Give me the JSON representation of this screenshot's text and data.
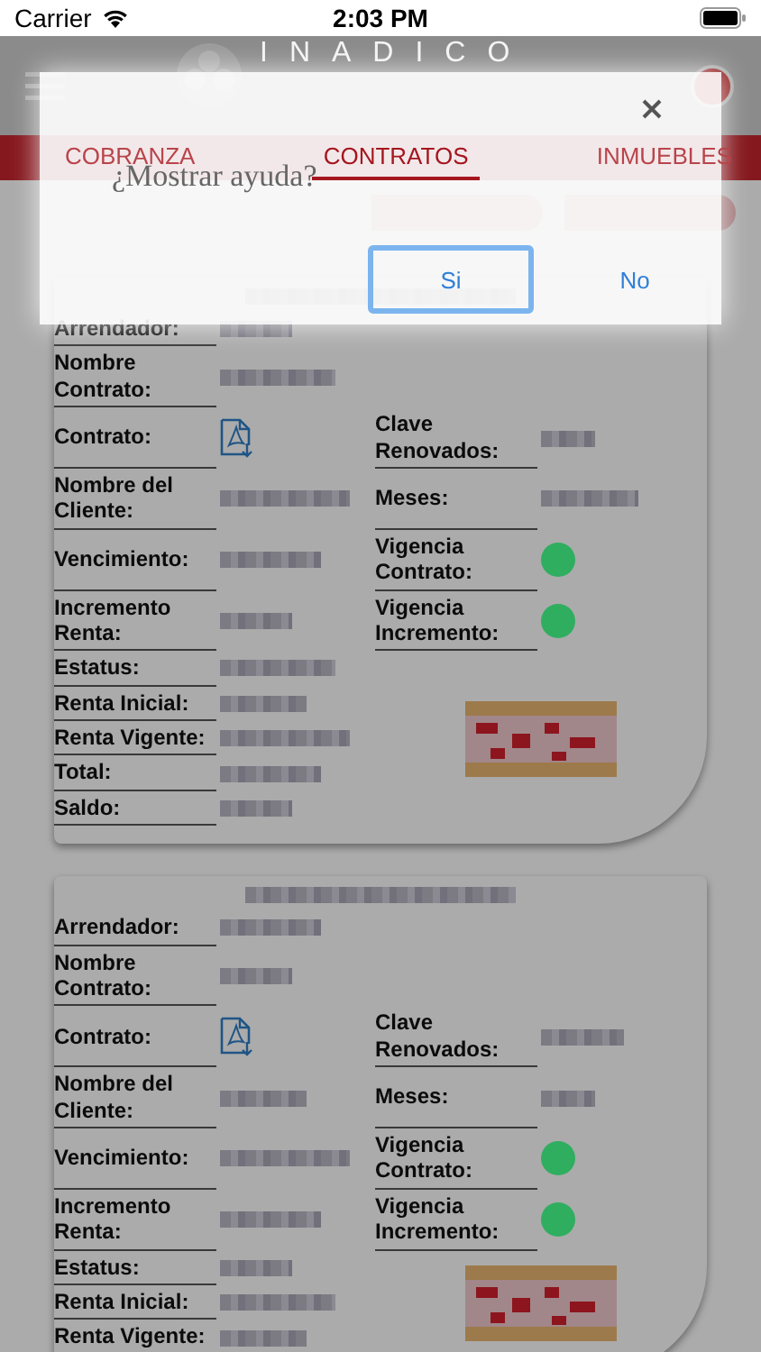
{
  "status_bar": {
    "carrier": "Carrier",
    "time": "2:03 PM"
  },
  "header": {
    "logo_text": "INADICO"
  },
  "tabs": [
    {
      "label": "COBRANZA",
      "selected": false
    },
    {
      "label": "CONTRATOS",
      "selected": true
    },
    {
      "label": "INMUEBLES",
      "selected": false
    }
  ],
  "cards": [
    {
      "rows": [
        {
          "label": "Arrendador:",
          "value": {
            "kind": "blurred"
          }
        },
        {
          "label": "Nombre Contrato:",
          "value": {
            "kind": "blurred"
          }
        },
        {
          "label": "Contrato:",
          "value": {
            "kind": "pdf"
          },
          "right": {
            "label": "Clave Renovados:",
            "value": {
              "kind": "blurred"
            }
          }
        },
        {
          "label": "Nombre del Cliente:",
          "value": {
            "kind": "blurred"
          },
          "right": {
            "label": "Meses:",
            "value": {
              "kind": "blurred"
            }
          }
        },
        {
          "label": "Vencimiento:",
          "value": {
            "kind": "blurred"
          },
          "right": {
            "label": "Vigencia Contrato:",
            "value": {
              "kind": "dot",
              "color": "#2fae5f"
            }
          }
        },
        {
          "label": "Incremento Renta:",
          "value": {
            "kind": "blurred"
          },
          "right": {
            "label": "Vigencia Incremento:",
            "value": {
              "kind": "dot",
              "color": "#2fae5f"
            }
          }
        },
        {
          "label": "Estatus:",
          "value": {
            "kind": "blurred"
          }
        },
        {
          "label": "Renta Inicial:",
          "value": {
            "kind": "blurred"
          }
        },
        {
          "label": "Renta Vigente:",
          "value": {
            "kind": "blurred"
          }
        },
        {
          "label": "Total:",
          "value": {
            "kind": "blurred"
          }
        },
        {
          "label": "Saldo:",
          "value": {
            "kind": "blurred"
          }
        }
      ]
    },
    {
      "rows": [
        {
          "label": "Arrendador:",
          "value": {
            "kind": "blurred"
          }
        },
        {
          "label": "Nombre Contrato:",
          "value": {
            "kind": "blurred"
          }
        },
        {
          "label": "Contrato:",
          "value": {
            "kind": "pdf"
          },
          "right": {
            "label": "Clave Renovados:",
            "value": {
              "kind": "blurred"
            }
          }
        },
        {
          "label": "Nombre del Cliente:",
          "value": {
            "kind": "blurred"
          },
          "right": {
            "label": "Meses:",
            "value": {
              "kind": "blurred"
            }
          }
        },
        {
          "label": "Vencimiento:",
          "value": {
            "kind": "blurred"
          },
          "right": {
            "label": "Vigencia Contrato:",
            "value": {
              "kind": "dot",
              "color": "#2fae5f"
            }
          }
        },
        {
          "label": "Incremento Renta:",
          "value": {
            "kind": "blurred"
          },
          "right": {
            "label": "Vigencia Incremento:",
            "value": {
              "kind": "dot",
              "color": "#2fae5f"
            }
          }
        },
        {
          "label": "Estatus:",
          "value": {
            "kind": "blurred"
          }
        },
        {
          "label": "Renta Inicial:",
          "value": {
            "kind": "blurred"
          }
        },
        {
          "label": "Renta Vigente:",
          "value": {
            "kind": "blurred"
          }
        }
      ]
    }
  ],
  "dialog": {
    "question": "¿Mostrar ayuda?",
    "buttons": [
      {
        "label": "Si",
        "focused": true
      },
      {
        "label": "No",
        "focused": false
      }
    ]
  }
}
